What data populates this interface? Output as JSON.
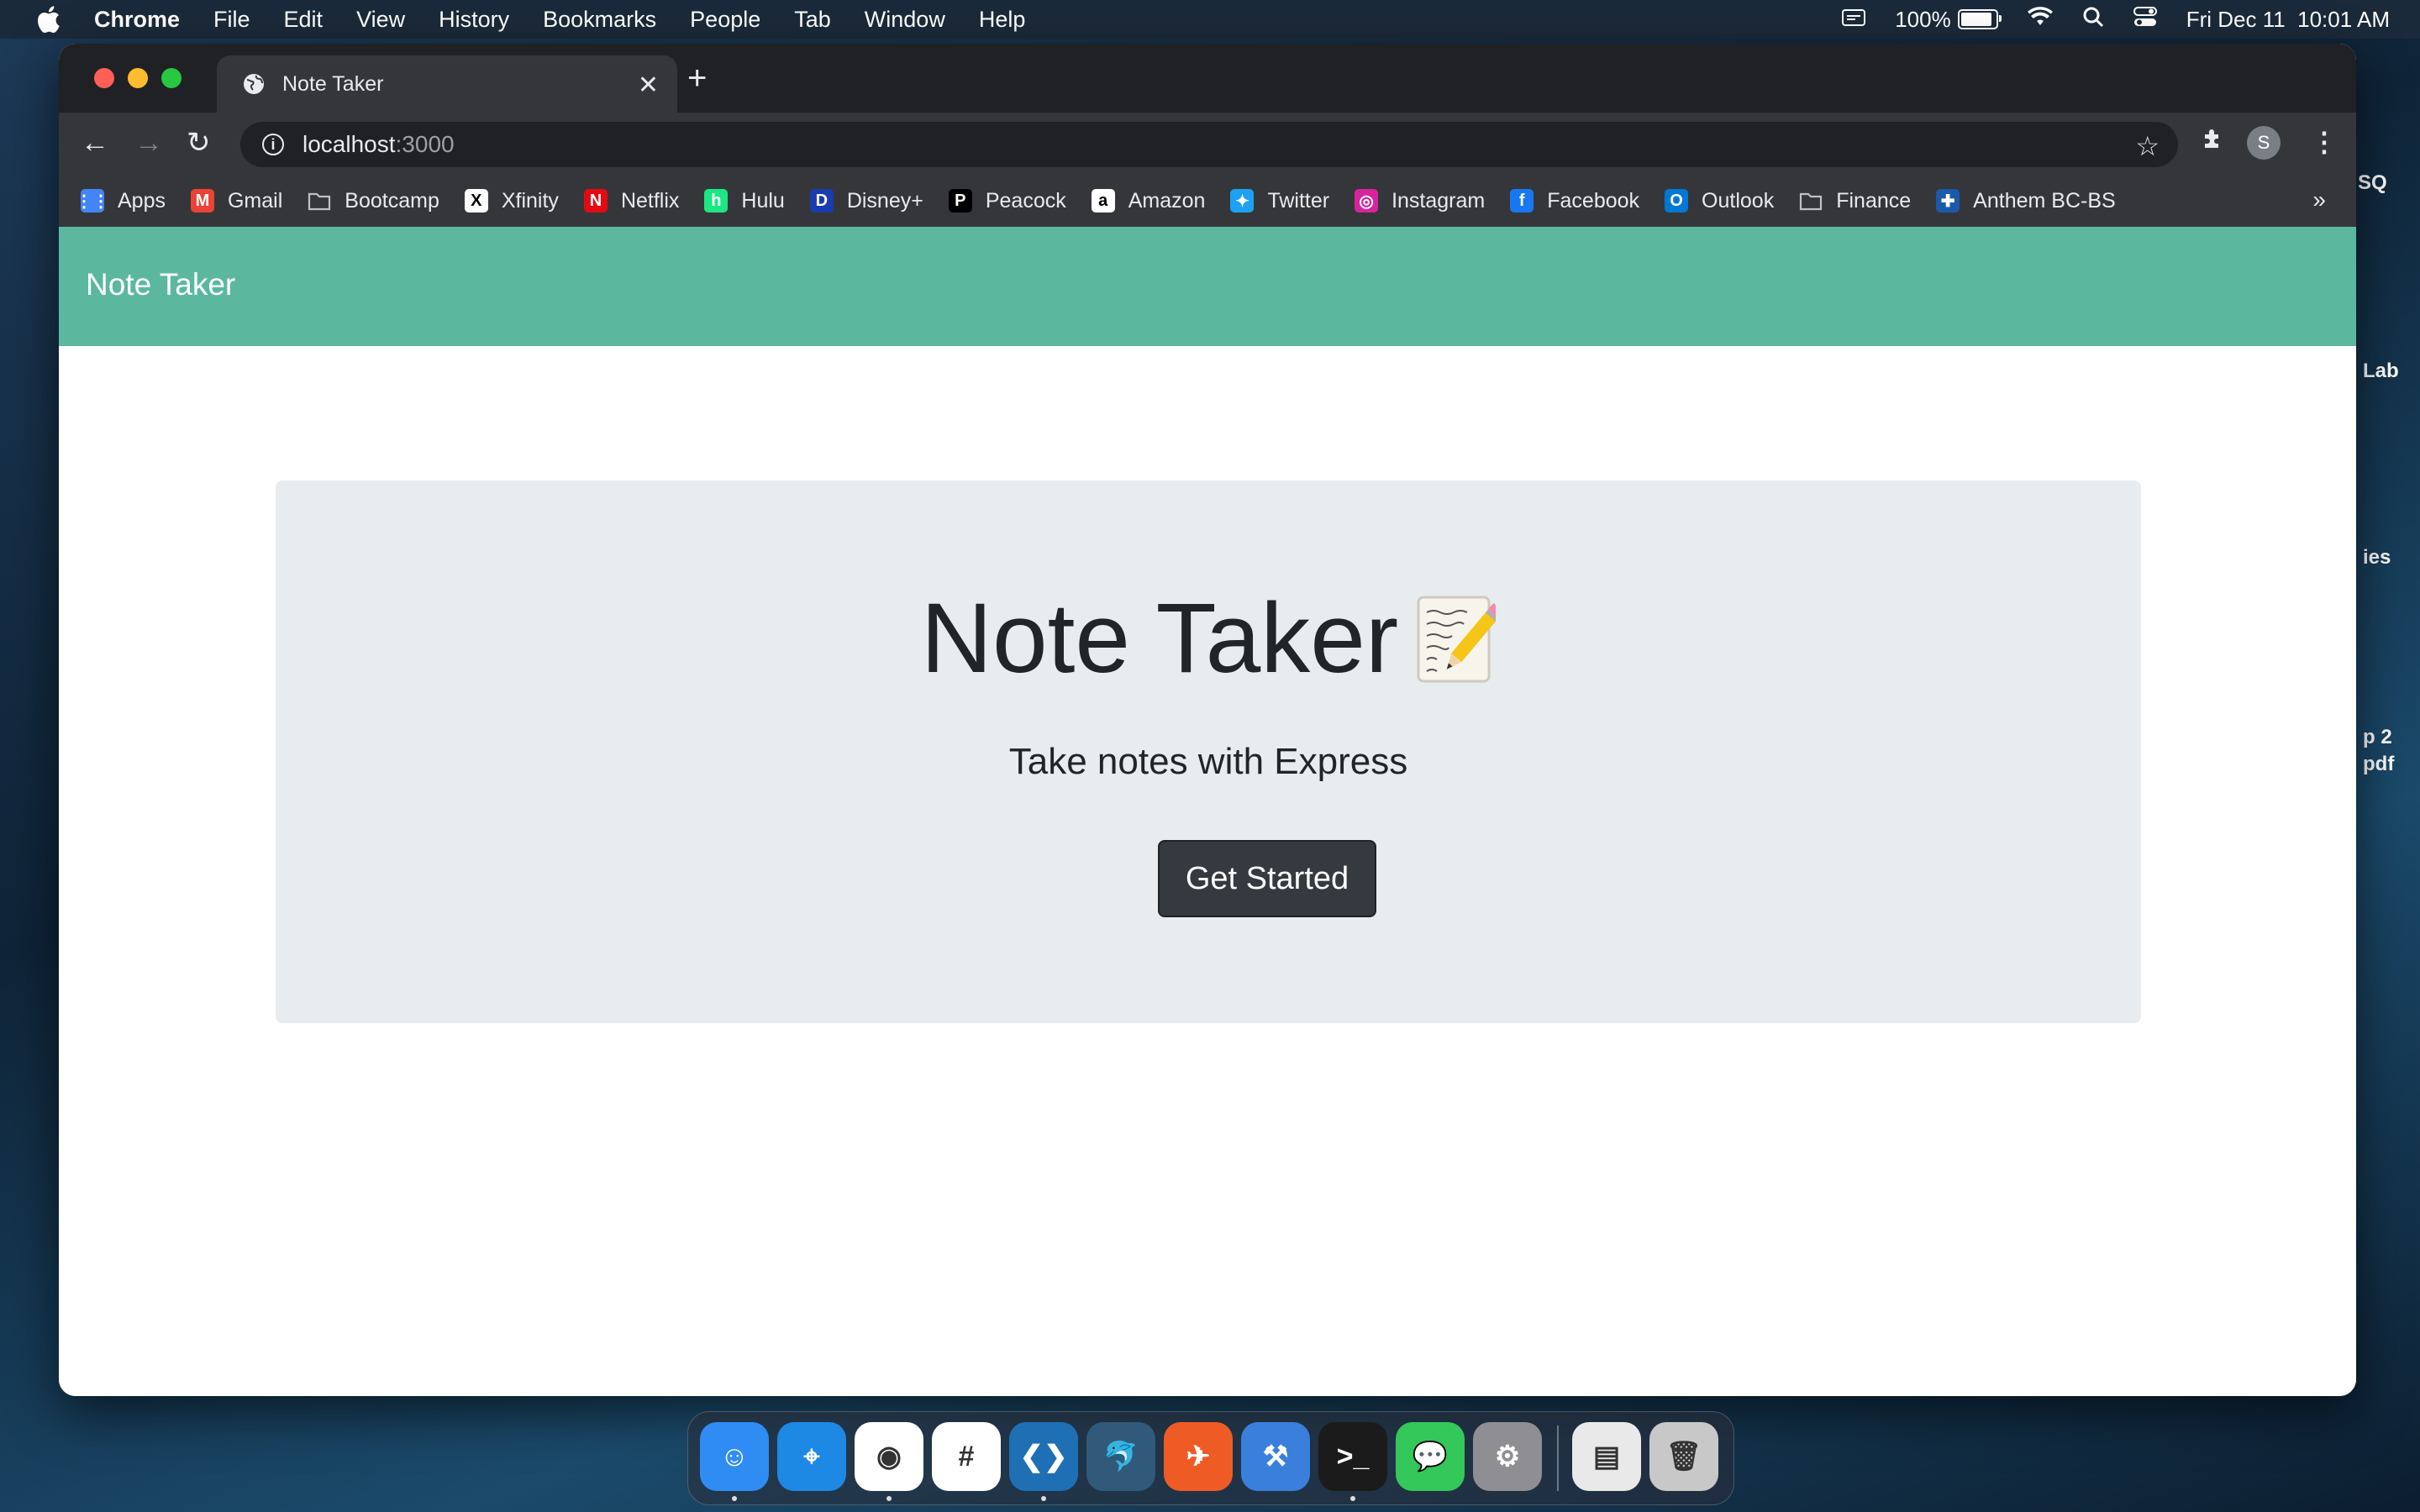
{
  "menubar": {
    "app_name": "Chrome",
    "items": [
      "File",
      "Edit",
      "View",
      "History",
      "Bookmarks",
      "People",
      "Tab",
      "Window",
      "Help"
    ],
    "battery_percent": "100%",
    "battery_level": 1.0,
    "datetime": "Fri Dec 11  10:01 AM"
  },
  "desktop": {
    "labels": [
      "SQ",
      "Lab",
      "ies",
      "p 2",
      "pdf"
    ]
  },
  "browser": {
    "tab_title": "Note Taker",
    "url_host": "localhost",
    "url_port": ":3000",
    "profile_initial": "S",
    "bookmarks": [
      {
        "label": "Apps",
        "icon": "apps-grid-icon",
        "color": "#4285f4"
      },
      {
        "label": "Gmail",
        "icon": "gmail-icon",
        "color": "#ea4335"
      },
      {
        "label": "Bootcamp",
        "icon": "folder-icon",
        "color": "#bdc1c6"
      },
      {
        "label": "Xfinity",
        "icon": "xfinity-icon",
        "color": "#ffffff"
      },
      {
        "label": "Netflix",
        "icon": "netflix-icon",
        "color": "#e50914"
      },
      {
        "label": "Hulu",
        "icon": "hulu-icon",
        "color": "#1ce783"
      },
      {
        "label": "Disney+",
        "icon": "disney-icon",
        "color": "#1a3cb0"
      },
      {
        "label": "Peacock",
        "icon": "peacock-icon",
        "color": "#000000"
      },
      {
        "label": "Amazon",
        "icon": "amazon-icon",
        "color": "#ffffff"
      },
      {
        "label": "Twitter",
        "icon": "twitter-icon",
        "color": "#1da1f2"
      },
      {
        "label": "Instagram",
        "icon": "instagram-icon",
        "color": "#d6249f"
      },
      {
        "label": "Facebook",
        "icon": "facebook-icon",
        "color": "#1877f2"
      },
      {
        "label": "Outlook",
        "icon": "outlook-icon",
        "color": "#0078d4"
      },
      {
        "label": "Finance",
        "icon": "folder-icon",
        "color": "#bdc1c6"
      },
      {
        "label": "Anthem BC-BS",
        "icon": "anthem-icon",
        "color": "#1a5aa8"
      }
    ],
    "more_label": "»"
  },
  "page": {
    "brand": "Note Taker",
    "heading": "Note Taker",
    "heading_emoji": "memo-icon",
    "lead": "Take notes with Express",
    "button_label": "Get Started",
    "navbar_color": "#5bb89e"
  },
  "dock": {
    "apps": [
      {
        "name": "Finder",
        "icon": "finder-icon",
        "color": "#2f8cf3",
        "running": true
      },
      {
        "name": "Safari",
        "icon": "safari-icon",
        "color": "#1e88e5",
        "running": false
      },
      {
        "name": "Chrome",
        "icon": "chrome-icon",
        "color": "#ffffff",
        "running": true
      },
      {
        "name": "Slack",
        "icon": "slack-icon",
        "color": "#ffffff",
        "running": false
      },
      {
        "name": "VS Code",
        "icon": "vscode-icon",
        "color": "#1f6fb5",
        "running": true
      },
      {
        "name": "MySQL Workbench",
        "icon": "mysql-workbench-icon",
        "color": "#31597a",
        "running": false
      },
      {
        "name": "Postman",
        "icon": "postman-icon",
        "color": "#ef5b25",
        "running": false
      },
      {
        "name": "Xcode",
        "icon": "xcode-icon",
        "color": "#3a7fdc",
        "running": false
      },
      {
        "name": "Terminal",
        "icon": "terminal-icon",
        "color": "#1b1b1b",
        "running": true
      },
      {
        "name": "Messages",
        "icon": "messages-icon",
        "color": "#34c759",
        "running": false
      },
      {
        "name": "System Preferences",
        "icon": "system-preferences-icon",
        "color": "#8e8e93",
        "running": false
      },
      {
        "name": "Preview",
        "icon": "preview-icon",
        "color": "#e9e9e9",
        "running": false
      },
      {
        "name": "Trash",
        "icon": "trash-icon",
        "color": "#c8c8c8",
        "running": false
      }
    ]
  }
}
